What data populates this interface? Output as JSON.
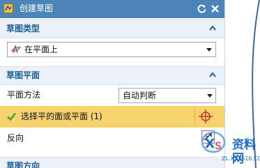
{
  "dialog": {
    "title": "创建草图",
    "sections": {
      "sketch_type": {
        "label": "草图类型",
        "dropdown_value": "在平面上"
      },
      "sketch_plane": {
        "label": "草图平面",
        "plane_method_label": "平面方法",
        "plane_method_value": "自动判断",
        "select_label": "选择平的面或平面 (1)",
        "reverse_label": "反向"
      },
      "sketch_orientation": {
        "label": "草图方向"
      }
    }
  },
  "watermark": {
    "text": "资料网",
    "url": "ZL.XS1616.COM"
  },
  "colors": {
    "titlebar": "#4a84b8",
    "section_header_bg": "#ebf1f8",
    "section_label": "#1f5d95",
    "selection_row": "#f7d36d",
    "check_green": "#3aa636",
    "crosshair_red": "#c0392b"
  }
}
